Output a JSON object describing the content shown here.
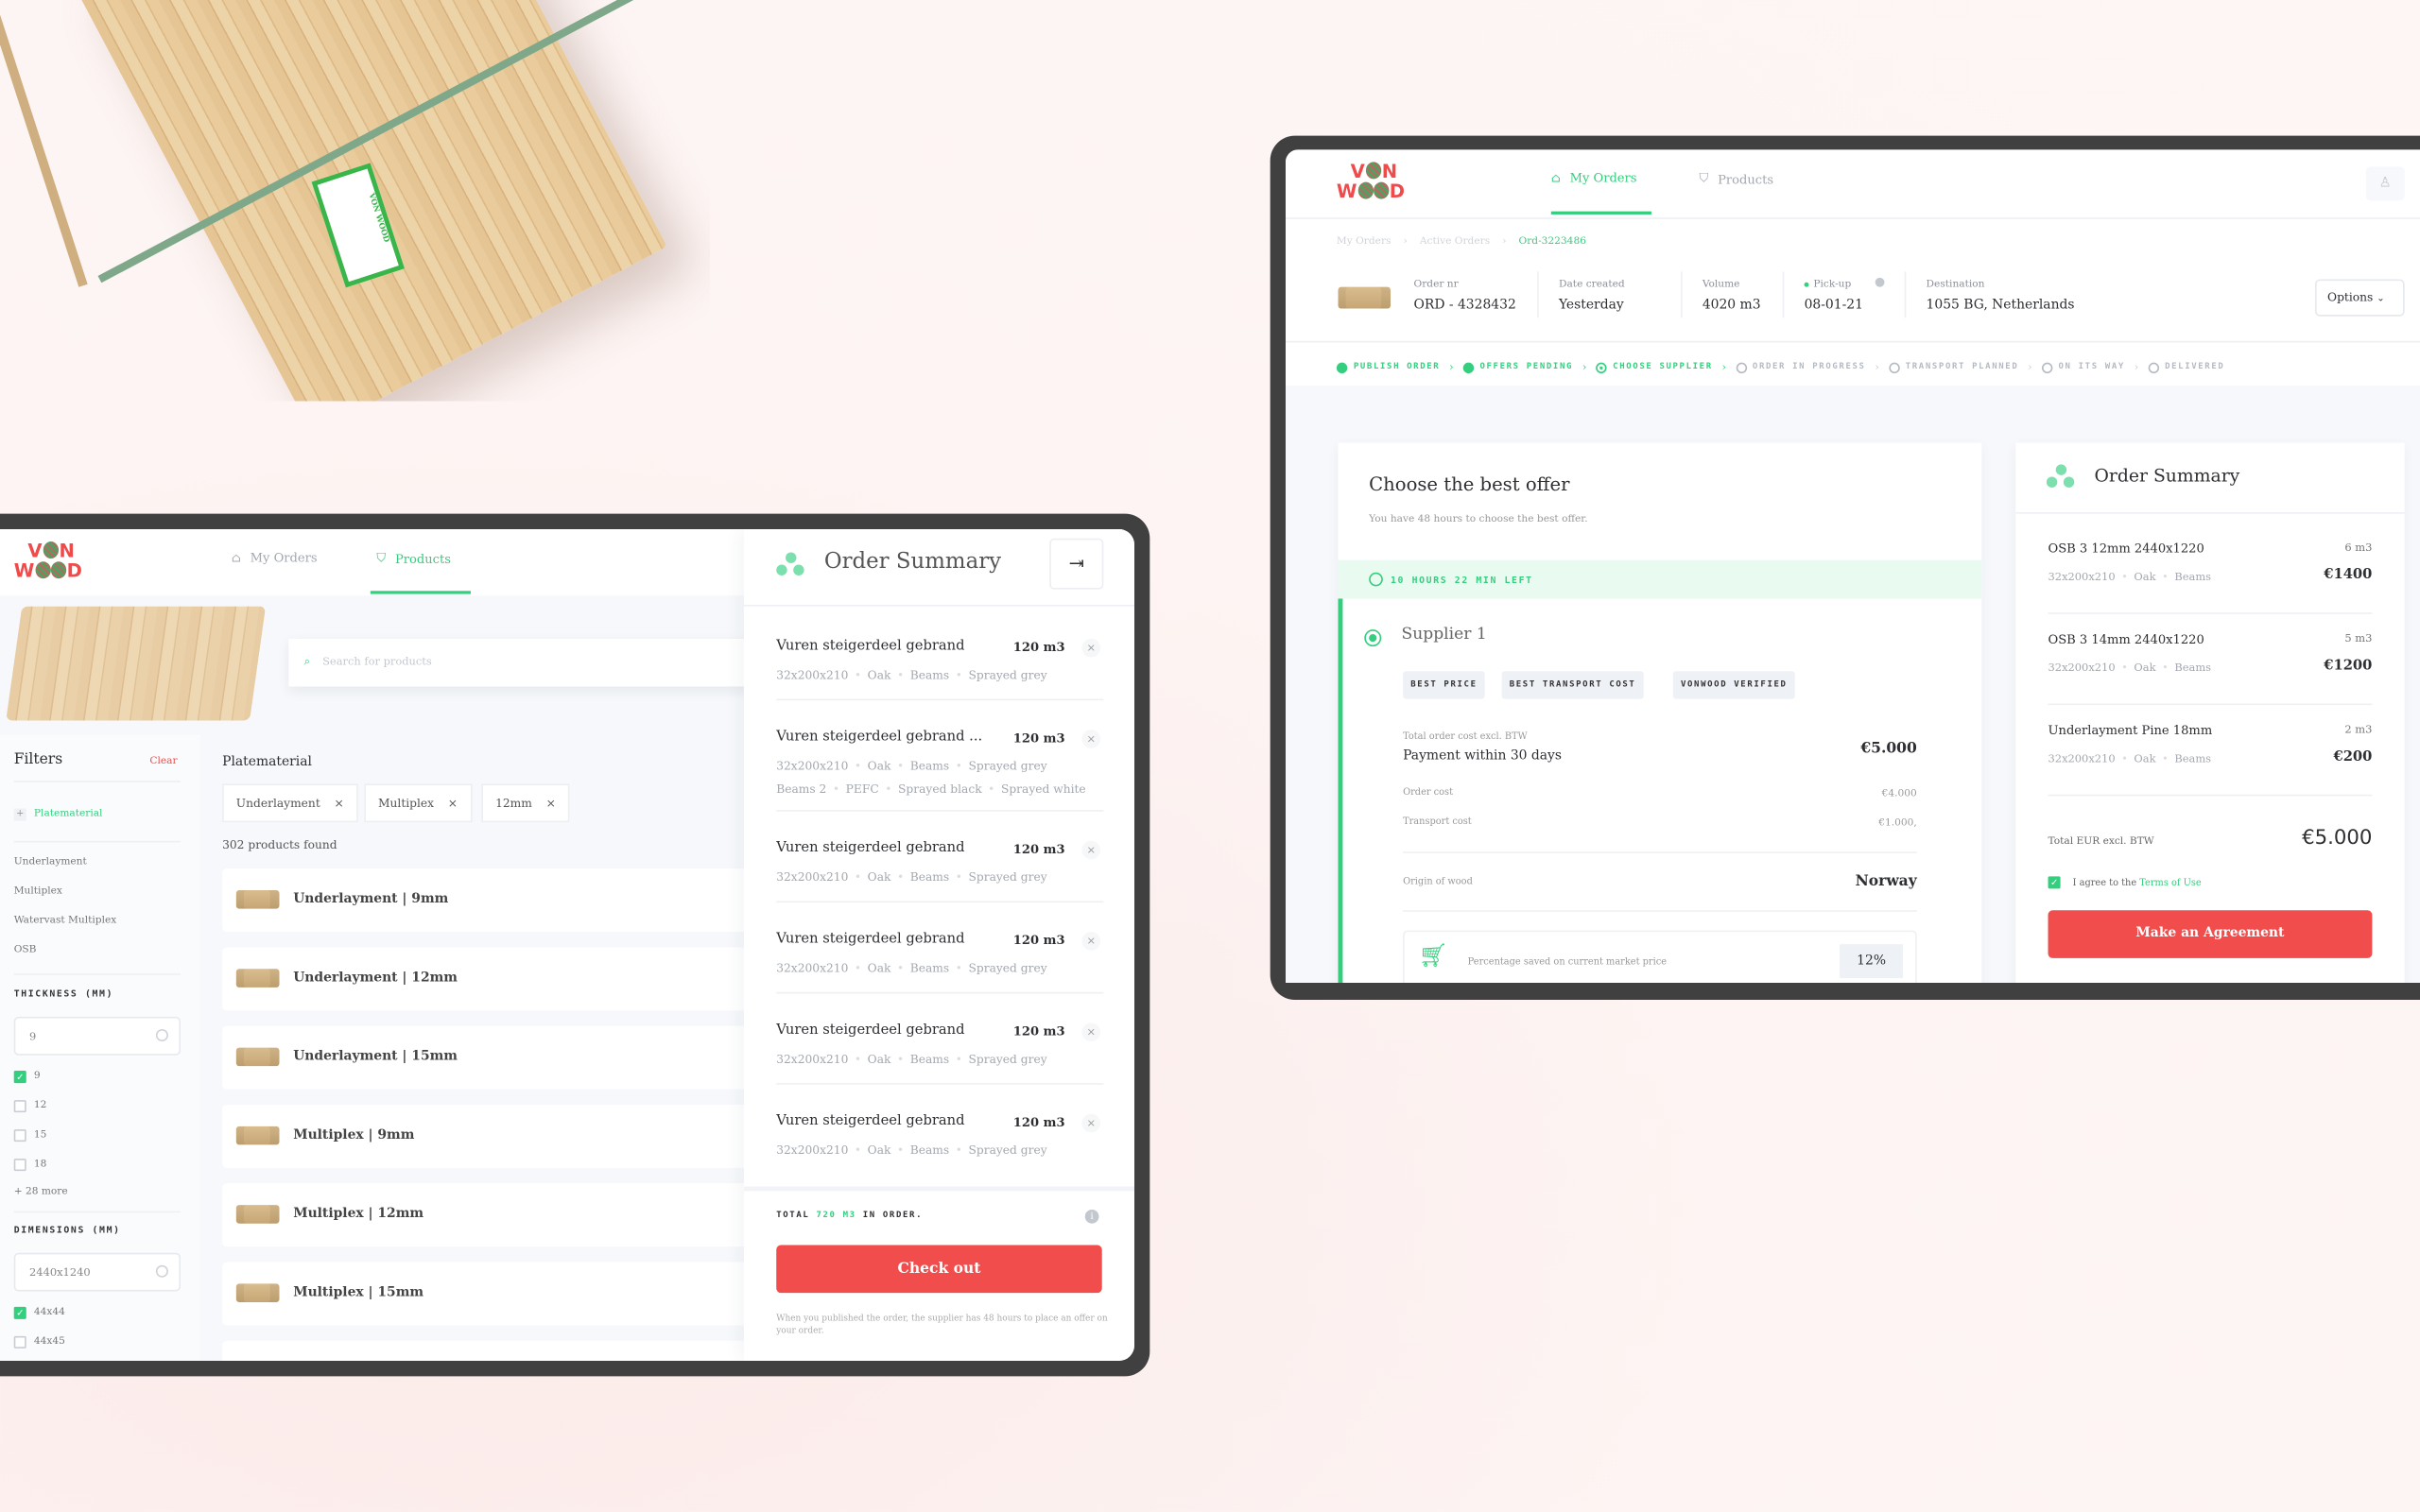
{
  "colors": {
    "accent_green": "#34cf7e",
    "accent_red": "#f24d4d",
    "frame": "#404040"
  },
  "logo": {
    "line1": "VON",
    "line2": "WOOD"
  },
  "bundle_label": "VON WOOD",
  "orders_screen": {
    "nav": [
      {
        "label": "My Orders",
        "icon": "home-icon",
        "active": true
      },
      {
        "label": "Products",
        "icon": "basket-icon",
        "active": false
      }
    ],
    "user_icon": "user-icon",
    "breadcrumb": [
      "My Orders",
      "Active Orders",
      "Ord-3223486"
    ],
    "order_info": [
      {
        "label": "Order nr",
        "value": "ORD - 4328432"
      },
      {
        "label": "Date created",
        "value": "Yesterday"
      },
      {
        "label": "Volume",
        "value": "4020 m3"
      },
      {
        "label": "Pick-up",
        "value": "08-01-21"
      },
      {
        "label": "Destination",
        "value": "1055 BG, Netherlands"
      }
    ],
    "options_label": "Options",
    "steps": [
      {
        "label": "PUBLISH ORDER",
        "state": "done"
      },
      {
        "label": "OFFERS PENDING",
        "state": "done"
      },
      {
        "label": "CHOOSE SUPPLIER",
        "state": "current"
      },
      {
        "label": "ORDER IN PROGRESS",
        "state": "todo"
      },
      {
        "label": "TRANSPORT PLANNED",
        "state": "todo"
      },
      {
        "label": "ON ITS WAY",
        "state": "todo"
      },
      {
        "label": "DELIVERED",
        "state": "todo"
      }
    ],
    "offer": {
      "title": "Choose the best offer",
      "subtitle": "You have 48 hours to choose the best offer.",
      "timer": "10 HOURS 22 MIN LEFT",
      "supplier": "Supplier 1",
      "tags": [
        "BEST PRICE",
        "BEST TRANSPORT COST",
        "VONWOOD VERIFIED"
      ],
      "total_label": "Total order cost excl. BTW",
      "payment": "Payment within 30 days",
      "total": "€5.000",
      "order_cost_label": "Order cost",
      "order_cost": "€4.000",
      "transport_cost_label": "Transport cost",
      "transport_cost": "€1.000,",
      "origin_label": "Origin of wood",
      "origin": "Norway",
      "saved_label": "Percentage saved on current market price",
      "saved": "12%"
    },
    "summary": {
      "title": "Order Summary",
      "items": [
        {
          "name": "OSB 3 12mm 2440x1220",
          "qty": "6 m3",
          "meta": [
            "32x200x210",
            "Oak",
            "Beams"
          ],
          "price": "€1400"
        },
        {
          "name": "OSB 3 14mm 2440x1220",
          "qty": "5 m3",
          "meta": [
            "32x200x210",
            "Oak",
            "Beams"
          ],
          "price": "€1200"
        },
        {
          "name": "Underlayment Pine 18mm",
          "qty": "2 m3",
          "meta": [
            "32x200x210",
            "Oak",
            "Beams"
          ],
          "price": "€200"
        }
      ],
      "total_label": "Total EUR excl. BTW",
      "total": "€5.000",
      "agree_prefix": "I agree to the",
      "agree_link": "Terms of Use",
      "agree_checked": true,
      "button": "Make an Agreement"
    }
  },
  "products_screen": {
    "nav": [
      {
        "label": "My Orders",
        "icon": "home-icon",
        "active": false
      },
      {
        "label": "Products",
        "icon": "basket-icon",
        "active": true
      }
    ],
    "search_placeholder": "Search for products",
    "filters": {
      "title": "Filters",
      "clear": "Clear",
      "category": "Platematerial",
      "types": [
        {
          "label": "Underlayment",
          "active": false
        },
        {
          "label": "Multiplex",
          "active": true
        },
        {
          "label": "Watervast Multiplex",
          "active": false
        },
        {
          "label": "OSB",
          "active": false
        }
      ],
      "thickness_title": "THICKNESS (MM)",
      "thickness_value": "9",
      "thickness_options": [
        {
          "label": "9",
          "checked": true
        },
        {
          "label": "12",
          "checked": false
        },
        {
          "label": "15",
          "checked": false
        },
        {
          "label": "18",
          "checked": false
        }
      ],
      "more": "+ 28 more",
      "dimensions_title": "DIMENSIONS (MM)",
      "dimensions_value": "2440x1240",
      "dimension_options": [
        {
          "label": "44x44",
          "checked": true
        },
        {
          "label": "44x45",
          "checked": false
        }
      ]
    },
    "heading": "Platematerial",
    "chips": [
      "Underlayment",
      "Multiplex",
      "12mm"
    ],
    "count": "302 products found",
    "products": [
      "Underlayment | 9mm",
      "Underlayment | 12mm",
      "Underlayment | 15mm",
      "Multiplex | 9mm",
      "Multiplex | 12mm",
      "Multiplex | 15mm"
    ],
    "summary": {
      "title": "Order Summary",
      "items": [
        {
          "name": "Vuren steigerdeel gebrand",
          "qty": "120 m3",
          "meta": [
            "32x200x210",
            "Oak",
            "Beams",
            "Sprayed grey"
          ]
        },
        {
          "name": "Vuren steigerdeel gebrand ...",
          "qty": "120 m3",
          "meta": [
            "32x200x210",
            "Oak",
            "Beams",
            "Sprayed grey"
          ],
          "meta2": [
            "Beams 2",
            "PEFC",
            "Sprayed black",
            "Sprayed white"
          ]
        },
        {
          "name": "Vuren steigerdeel gebrand",
          "qty": "120 m3",
          "meta": [
            "32x200x210",
            "Oak",
            "Beams",
            "Sprayed grey"
          ]
        },
        {
          "name": "Vuren steigerdeel gebrand",
          "qty": "120 m3",
          "meta": [
            "32x200x210",
            "Oak",
            "Beams",
            "Sprayed grey"
          ]
        },
        {
          "name": "Vuren steigerdeel gebrand",
          "qty": "120 m3",
          "meta": [
            "32x200x210",
            "Oak",
            "Beams",
            "Sprayed grey"
          ]
        },
        {
          "name": "Vuren steigerdeel gebrand",
          "qty": "120 m3",
          "meta": [
            "32x200x210",
            "Oak",
            "Beams",
            "Sprayed grey"
          ]
        }
      ],
      "total_prefix": "TOTAL",
      "total_value": "720 M3",
      "total_suffix": "IN ORDER.",
      "button": "Check out",
      "note": "When you published the order, the supplier has 48 hours to place an offer on your order."
    }
  }
}
